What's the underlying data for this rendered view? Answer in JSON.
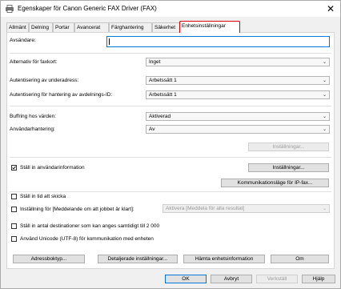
{
  "window": {
    "title": "Egenskaper för Canon Generic FAX Driver (FAX)",
    "close_glyph": "✕"
  },
  "tabs": [
    {
      "label": "Allmänt"
    },
    {
      "label": "Delning"
    },
    {
      "label": "Portar"
    },
    {
      "label": "Avancerat"
    },
    {
      "label": "Färghantering"
    },
    {
      "label": "Säkerhet"
    },
    {
      "label": "Enhetsinställningar",
      "active": true
    }
  ],
  "sender": {
    "label": "Avsändare:",
    "value": ""
  },
  "fax_card": {
    "label": "Alternativ för faxkort:",
    "value": "Inget"
  },
  "sub_auth": {
    "label": "Autentisering av underadress:",
    "value": "Arbetssätt 1"
  },
  "dept_auth": {
    "label": "Autentisering för hantering av avdelnings-ID:",
    "value": "Arbetssätt 1"
  },
  "buffer": {
    "label": "Buffring hos värden:",
    "value": "Aktiverad"
  },
  "user_mgmt": {
    "label": "Användarhantering:",
    "value": "Av"
  },
  "buttons": {
    "settings_disabled": "Inställningar...",
    "settings": "Inställningar...",
    "comm_mode": "Kommunikationsläge för IP-fax...",
    "address_book": "Adressboktyp...",
    "detailed": "Detaljerade inställningar...",
    "fetch_info": "Hämta enhetsinformation",
    "about": "Om",
    "ok": "OK",
    "cancel": "Avbryt",
    "apply": "Verkställ",
    "help": "Hjälp"
  },
  "checkboxes": {
    "user_info": {
      "label": "Ställ in användarinformation",
      "checked": true
    },
    "send_time": {
      "label": "Ställ in tid att skicka",
      "checked": false
    },
    "notify": {
      "label": "Inställning för [Meddelande om att jobbet är klart]:",
      "checked": false
    },
    "dest_count": {
      "label": "Ställ in antal destinationer som kan anges samtidigt till 2 000",
      "checked": false
    },
    "unicode": {
      "label": "Använd Unicode (UTF-8) för kommunikation med enheten",
      "checked": false
    }
  },
  "notify_select": {
    "value": "Aktivera [Meddela för alla resultat]"
  },
  "colors": {
    "accent": "#0078d7",
    "active_tab_border": "#dd0000"
  }
}
